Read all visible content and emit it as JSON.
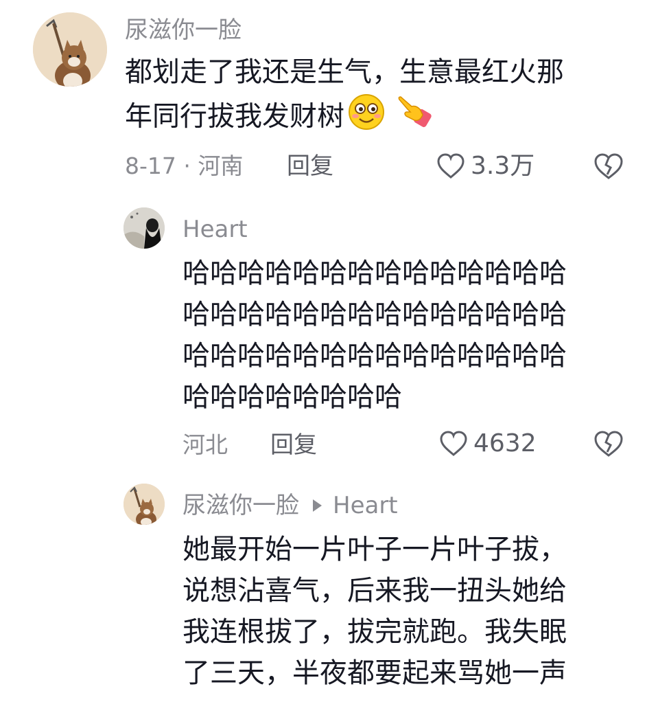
{
  "comment": {
    "username": "尿滋你一脸",
    "text_line1": "都划走了我还是生气，生意最红火那",
    "text_line2": "年同行拔我发财树",
    "emojis": [
      "smiling-face-emoji",
      "pointing-hand-emoji"
    ],
    "date_location": "8-17 · 河南",
    "reply_label": "回复",
    "likes": "3.3万"
  },
  "reply1": {
    "username": "Heart",
    "text_lines": [
      "哈哈哈哈哈哈哈哈哈哈哈哈哈哈",
      "哈哈哈哈哈哈哈哈哈哈哈哈哈哈",
      "哈哈哈哈哈哈哈哈哈哈哈哈哈哈",
      "哈哈哈哈哈哈哈哈"
    ],
    "location": "河北",
    "reply_label": "回复",
    "likes": "4632"
  },
  "reply2": {
    "username": "尿滋你一脸",
    "reply_to": "Heart",
    "text_lines": [
      "她最开始一片叶子一片叶子拔，",
      "说想沾喜气，后来我一扭头她给",
      "我连根拔了，拔完就跑。我失眠",
      "了三天，半夜都要起来骂她一声"
    ]
  },
  "colors": {
    "text": "#161823",
    "secondary": "#8a8b91",
    "action": "#5c5e66"
  }
}
